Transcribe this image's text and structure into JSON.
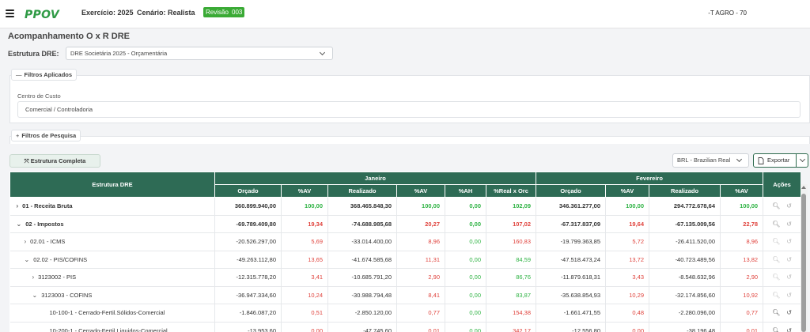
{
  "header": {
    "logo": "PPOV",
    "exercicio": "Exercício: 2025",
    "cenario": "Cenário: Realista",
    "revisao_label": "Revisão",
    "revisao_num": "003",
    "company": "-T AGRO - 70"
  },
  "page": {
    "title": "Acompanhamento O x R DRE",
    "structure_label": "Estrutura DRE:",
    "structure_value": "DRE Societária 2025 - Orçamentária"
  },
  "filters": {
    "applied_label": "Filtros Aplicados",
    "applied_symbol": "—",
    "cost_center_label": "Centro de Custo",
    "cost_center_value": "Comercial / Controladoria",
    "search_label": "Filtros de Pesquisa",
    "search_symbol": "+"
  },
  "toolbar": {
    "structure_button": "Estrutura Completa",
    "structure_icon": "⤧",
    "currency": "BRL - Brazilian Real",
    "export": "Exportar"
  },
  "table": {
    "first_col": "Estrutura DRE",
    "months": [
      "Janeiro",
      "Fevereiro"
    ],
    "actions_col": "Ações",
    "jan_cols": [
      "Orçado",
      "%AV",
      "Realizado",
      "%AV",
      "%AH",
      "%Real x Orc"
    ],
    "feb_cols": [
      "Orçado",
      "%AV",
      "Realizado",
      "%AV"
    ],
    "rows": [
      {
        "name": "01 - Receita Bruta",
        "exp": "›",
        "bold": true,
        "jan": [
          "360.899.940,00",
          "100,00",
          "368.465.848,30",
          "100,00",
          "0,00",
          "102,09"
        ],
        "feb": [
          "346.361.277,00",
          "100,00",
          "294.772.678,64",
          "100,00"
        ]
      },
      {
        "name": "02 - Impostos",
        "exp": "⌄",
        "bold": true,
        "jan": [
          "-69.789.409,80",
          "19,34",
          "-74.688.985,68",
          "20,27",
          "0,00",
          "107,02"
        ],
        "feb": [
          "-67.317.837,09",
          "19,64",
          "-67.135.009,56",
          "22,78"
        ]
      },
      {
        "name": "02.01 - ICMS",
        "exp": "›",
        "bold": false,
        "jan": [
          "-20.526.297,00",
          "5,69",
          "-33.014.400,00",
          "8,96",
          "0,00",
          "160,83"
        ],
        "feb": [
          "-19.799.363,85",
          "5,72",
          "-26.411.520,00",
          "8,96"
        ]
      },
      {
        "name": "02.02 - PIS/COFINS",
        "exp": "⌄",
        "bold": false,
        "jan": [
          "-49.263.112,80",
          "13,65",
          "-41.674.585,68",
          "11,31",
          "0,00",
          "84,59"
        ],
        "feb": [
          "-47.518.473,24",
          "13,72",
          "-40.723.489,56",
          "13,82"
        ]
      },
      {
        "name": "3123002 - PIS",
        "exp": "›",
        "bold": false,
        "jan": [
          "-12.315.778,20",
          "3,41",
          "-10.685.791,20",
          "2,90",
          "0,00",
          "86,76"
        ],
        "feb": [
          "-11.879.618,31",
          "3,43",
          "-8.548.632,96",
          "2,90"
        ]
      },
      {
        "name": "3123003 - COFINS",
        "exp": "⌄",
        "bold": false,
        "jan": [
          "-36.947.334,60",
          "10,24",
          "-30.988.794,48",
          "8,41",
          "0,00",
          "83,87"
        ],
        "feb": [
          "-35.638.854,93",
          "10,29",
          "-32.174.856,60",
          "10,92"
        ]
      },
      {
        "name": "10-100-1 - Cerrado-Fertil.Sólidos-Comercial",
        "exp": "",
        "bold": false,
        "jan": [
          "-1.846.087,20",
          "0,51",
          "-2.850.120,00",
          "0,77",
          "0,00",
          "154,38"
        ],
        "feb": [
          "-1.661.471,55",
          "0,48",
          "-2.280.096,00",
          "0,77"
        ]
      },
      {
        "name": "10-200-1 - Cerrado-Fertil.Liquidos-Comercial",
        "exp": "",
        "bold": false,
        "jan": [
          "-13.953,60",
          "0,00",
          "-47.745,60",
          "0,01",
          "0,00",
          "342,17"
        ],
        "feb": [
          "-12.556,80",
          "0,00",
          "-38.196,48",
          "0,01"
        ]
      }
    ]
  },
  "colors": {
    "header_green": "#2e6b55",
    "positive": "#2fb344",
    "negative": "#e0433d",
    "badge": "#3aaa35"
  }
}
